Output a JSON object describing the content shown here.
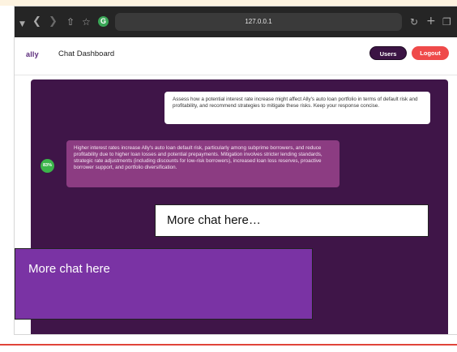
{
  "browser": {
    "url": "127.0.0.1",
    "icons": {
      "sidebar": "sidebar-icon",
      "back": "chevron-left-icon",
      "forward": "chevron-right-icon",
      "share": "share-icon",
      "bookmark": "star-icon",
      "extension": "g-extension-icon",
      "reload": "reload-icon",
      "new_tab": "plus-icon",
      "tab_overview": "tabs-icon"
    },
    "extension_badge": "G"
  },
  "header": {
    "logo": "ally",
    "title": "Chat Dashboard",
    "users_label": "Users",
    "logout_label": "Logout"
  },
  "chat": {
    "messages": [
      {
        "role": "user",
        "text": "Assess how a potential interest rate increase might affect Ally's auto loan portfolio in terms of default risk and profitability, and recommend strategies to mitigate these risks. Keep your response concise."
      },
      {
        "role": "assistant",
        "score": "83%",
        "text": "Higher interest rates increase Ally's auto loan default risk, particularly among subprime borrowers, and reduce profitability due to higher loan losses and potential prepayments. Mitigation involves stricter lending standards, strategic rate adjustments (including discounts for low-risk borrowers), increased loan loss reserves, proactive borrower support, and portfolio diversification."
      }
    ],
    "placeholder_1": "More chat here…",
    "placeholder_2": "More chat here"
  },
  "colors": {
    "chat_background": "#3f1548",
    "assistant_bubble": "#8c3c82",
    "users_button": "#3b1444",
    "logout_button": "#ef4a4a",
    "score_badge": "#3bb54a",
    "overlay_purple": "#7a33a4"
  }
}
